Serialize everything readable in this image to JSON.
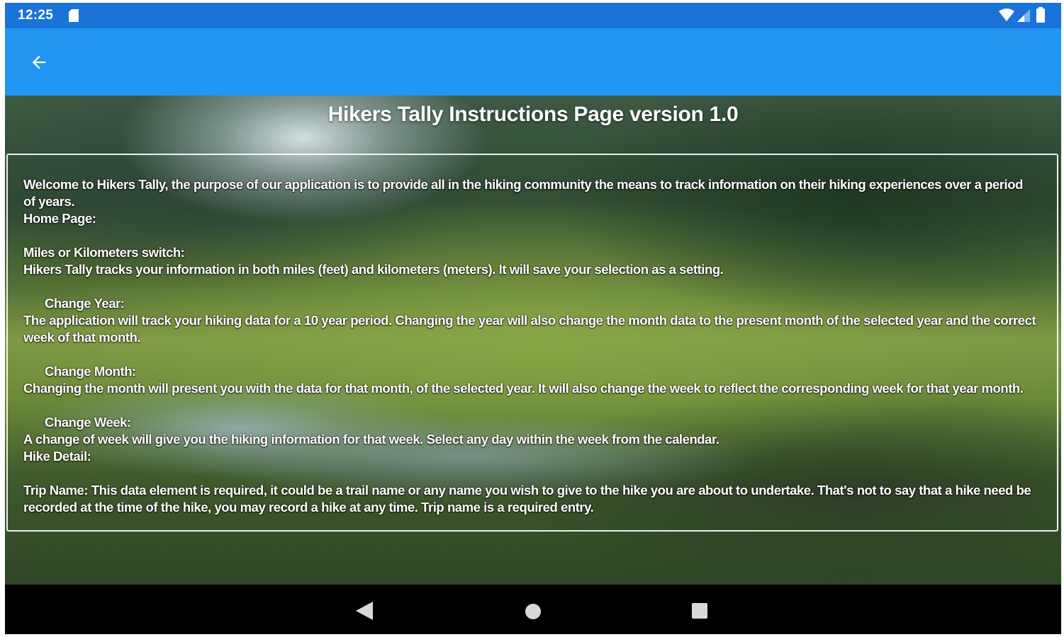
{
  "status_bar": {
    "time": "12:25",
    "icons": [
      "sd-card-icon",
      "wifi-icon",
      "signal-icon",
      "battery-icon"
    ]
  },
  "app_bar": {
    "back_icon": "arrow-left-icon",
    "background_color": "#2196f3",
    "status_color": "#1a73d9"
  },
  "page": {
    "title": "Hikers Tally Instructions Page version 1.0"
  },
  "instructions": {
    "welcome": "Welcome to Hikers Tally, the purpose of our application is to provide all in the hiking community the means to track information on their hiking experiences over a period of years.",
    "home_page_heading": "Home Page:",
    "miles_km_heading": "Miles or Kilometers switch:",
    "miles_km_text": "Hikers Tally tracks your information in both miles (feet) and kilometers (meters).  It will save your selection as a setting.",
    "change_year_heading": "Change Year:",
    "change_year_text": "The application will track your hiking data for a 10 year period.  Changing the year will also change the month data to the present month of the selected year and the correct week of that month.",
    "change_month_heading": "Change Month:",
    "change_month_text": "Changing the month will present you with the data for that month, of the selected year.  It will also change the week to reflect the corresponding week for that year month.",
    "change_week_heading": "Change Week:",
    "change_week_text": "A change of week will give you the hiking information for that week.  Select any day within the week from the calendar.",
    "hike_detail_heading": "Hike Detail:",
    "trip_name_text": "Trip Name:  This data element is required, it could be a trail name or any name you wish to give to the hike you are about to undertake.  That's not to say that a hike need be recorded at the time of the hike, you may record a hike at any time.  Trip name is a required entry."
  },
  "nav_bar": {
    "icons": [
      "nav-back-icon",
      "nav-home-icon",
      "nav-recents-icon"
    ]
  }
}
